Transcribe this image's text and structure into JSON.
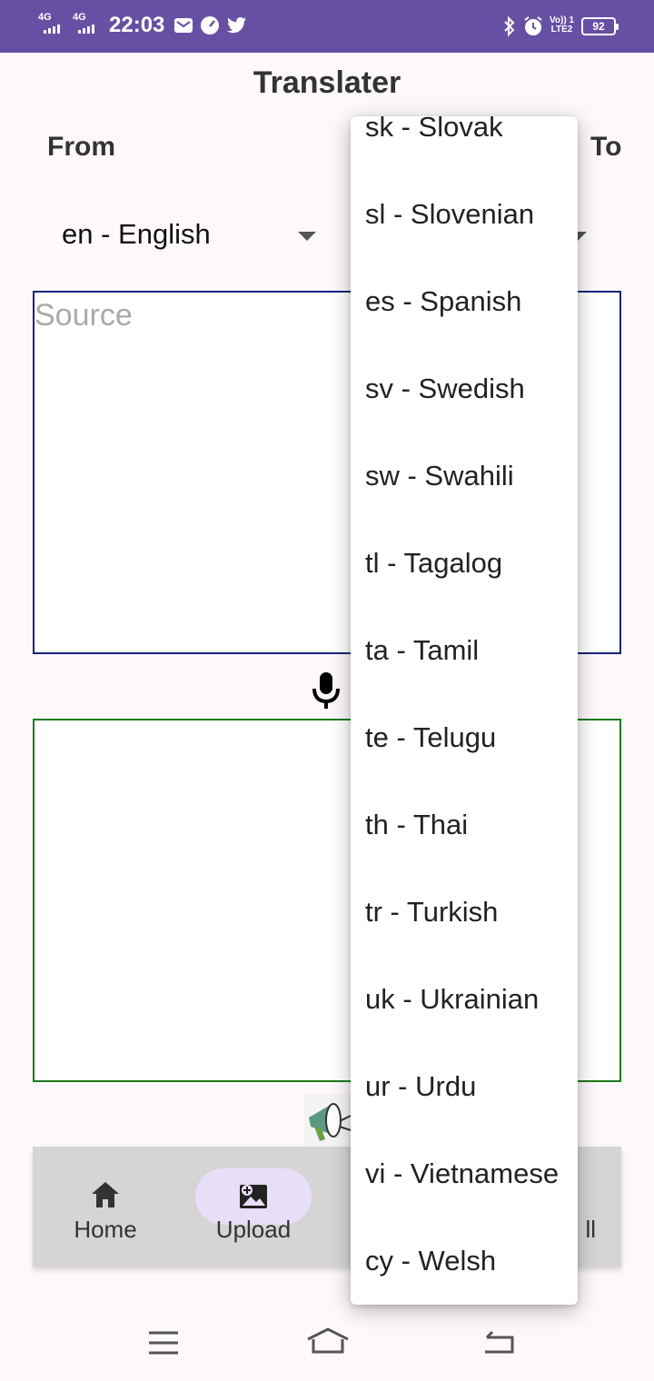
{
  "status_bar": {
    "time": "22:03",
    "sim1": "4G",
    "sim2": "4G",
    "volte": "Vo)) 1",
    "lte": "LTE2",
    "battery": "92",
    "icons": [
      "gmail-icon",
      "speed-icon",
      "twitter-icon",
      "bluetooth-icon",
      "alarm-icon"
    ]
  },
  "app": {
    "title": "Translater",
    "from_label": "From",
    "to_label": "To"
  },
  "from_language": {
    "selected": "en - English"
  },
  "source": {
    "placeholder": "Source",
    "value": ""
  },
  "target": {
    "value": ""
  },
  "bottom_nav": {
    "items": [
      {
        "label": "Home",
        "icon": "home-icon"
      },
      {
        "label": "Upload",
        "icon": "image-upload-icon",
        "selected": true
      },
      {
        "label": "ll",
        "icon": ""
      }
    ]
  },
  "dropdown": {
    "options": [
      "sk - Slovak",
      "sl - Slovenian",
      "es - Spanish",
      "sv - Swedish",
      "sw - Swahili",
      "tl - Tagalog",
      "ta - Tamil",
      "te - Telugu",
      "th - Thai",
      "tr - Turkish",
      "uk - Ukrainian",
      "ur - Urdu",
      "vi - Vietnamese",
      "cy - Welsh"
    ]
  },
  "colors": {
    "status_bar": "#6750a4",
    "source_border": "#1a237e",
    "target_border": "#1b7a1b",
    "nav_pill": "#e8def8"
  }
}
